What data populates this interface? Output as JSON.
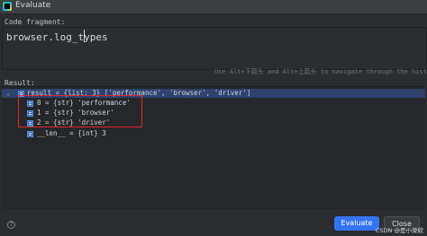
{
  "window": {
    "title": "Evaluate"
  },
  "fragment": {
    "label": "Code fragment:",
    "value": "browser.log_types"
  },
  "hint": "Use Alt+下箭头 and Alt+上箭头 to navigate through the history",
  "result": {
    "label": "Result:",
    "root": "result = {list: 3} ['performance', 'browser', 'driver']",
    "items": [
      "0 = {str} 'performance'",
      "1 = {str} 'browser'",
      "2 = {str} 'driver'",
      "__len__ = {int} 3"
    ]
  },
  "buttons": {
    "evaluate": "Evaluate",
    "close": "Close",
    "help": "?"
  },
  "watermark": "CSDN @是小菜欸",
  "colors": {
    "selection": "#2e436e",
    "primary_button": "#3574f0",
    "highlight_box": "#e0262b"
  }
}
